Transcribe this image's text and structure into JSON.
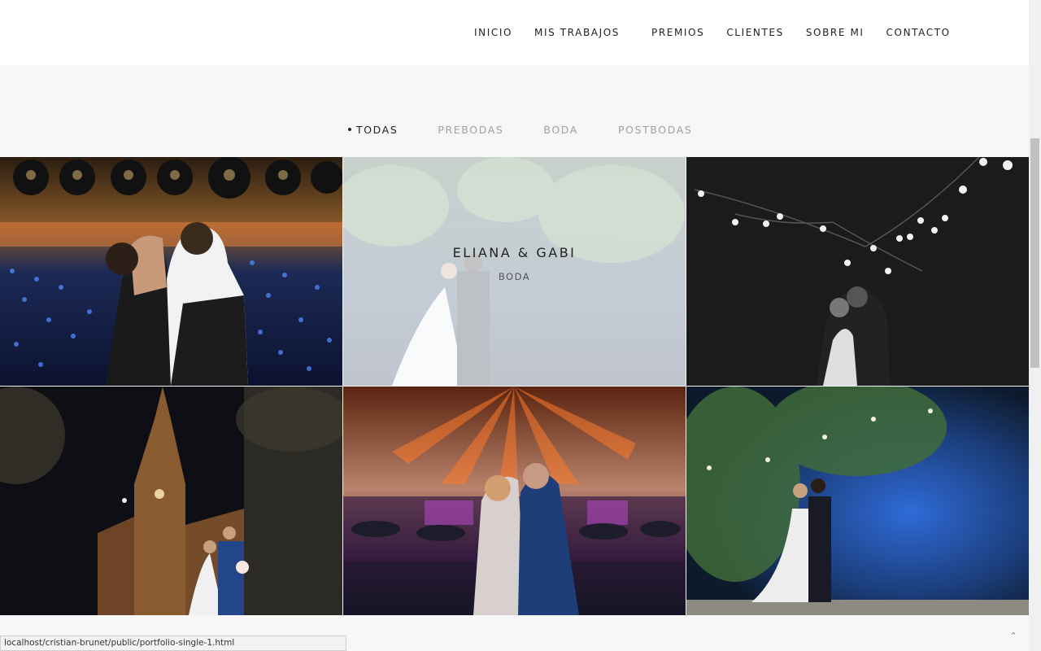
{
  "nav": {
    "items": [
      "INICIO",
      "MIS TRABAJOS",
      "PREMIOS",
      "CLIENTES",
      "SOBRE MI",
      "CONTACTO"
    ]
  },
  "filters": {
    "items": [
      "TODAS",
      "PREBODAS",
      "BODA",
      "POSTBODAS"
    ],
    "active": "TODAS"
  },
  "gallery": {
    "hover_title": "ELIANA & GABI",
    "hover_category": "BODA"
  },
  "status_bar": {
    "url": "localhost/cristian-brunet/public/portfolio-single-1.html"
  },
  "back_to_top": {
    "glyph": "⌃"
  },
  "icons": {
    "back_to_top": "chevron-up-icon"
  }
}
